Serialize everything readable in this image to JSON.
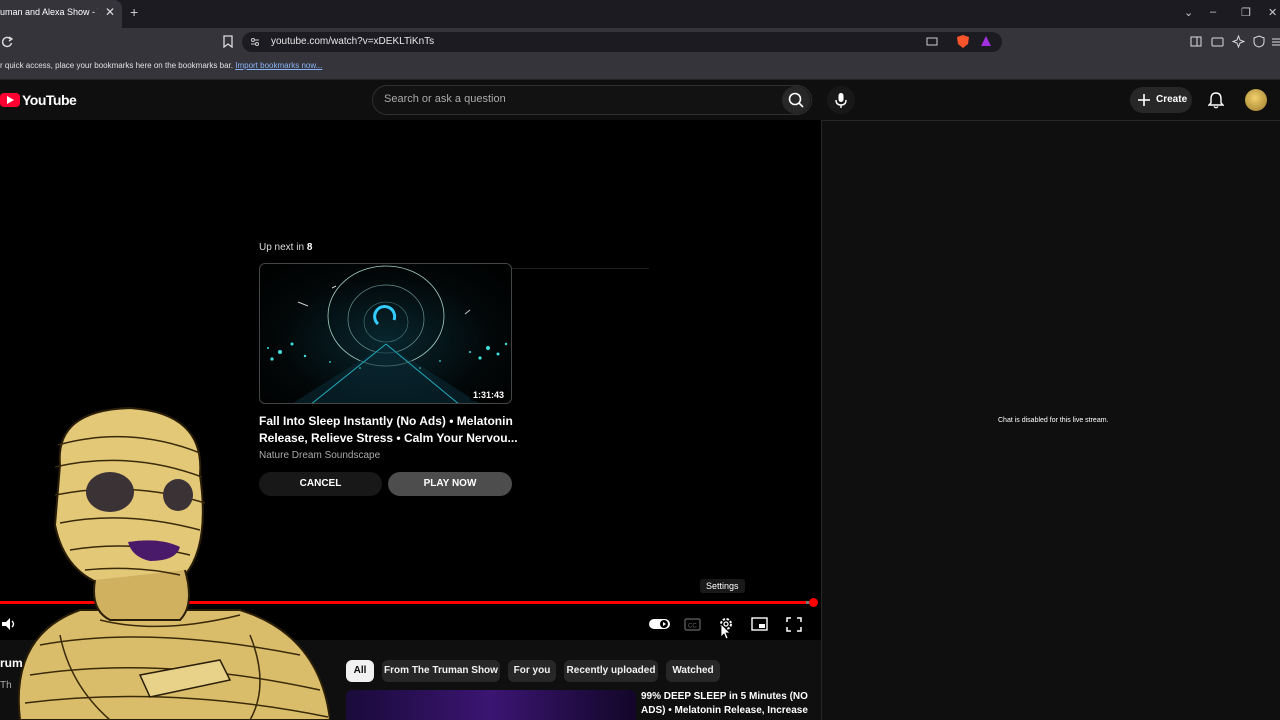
{
  "browser": {
    "tab_title": "uman and Alexa Show - Y",
    "url": "youtube.com/watch?v=xDEKLTiKnTs",
    "bookmarks_text": "r quick access, place your bookmarks here on the bookmarks bar.",
    "bookmarks_link": "Import bookmarks now..."
  },
  "header": {
    "logo": "YouTube",
    "search_placeholder": "Search or ask a question",
    "create_label": "Create"
  },
  "player": {
    "upnext_label": "Up next in",
    "upnext_count": "8",
    "video_title": "Fall Into Sleep Instantly (No Ads) • Melatonin Release, Relieve Stress • Calm Your Nervou...",
    "channel": "Nature Dream Soundscape",
    "duration": "1:31:43",
    "cancel_label": "CANCEL",
    "play_label": "PLAY NOW",
    "settings_tooltip": "Settings",
    "progress_fraction": 0.99
  },
  "chat": {
    "message": "Chat is disabled for this live stream."
  },
  "chips": [
    "All",
    "From The Truman Show",
    "For you",
    "Recently uploaded",
    "Watched"
  ],
  "recommendation": {
    "title": "99% DEEP SLEEP in 5 Minutes (NO ADS) • Melatonin Release, Increase"
  },
  "channel_info": {
    "name": "rum",
    "sub": "Th"
  },
  "colors": {
    "accent": "#ff0000",
    "background": "#0f0f0f",
    "chrome": "#35343b"
  }
}
